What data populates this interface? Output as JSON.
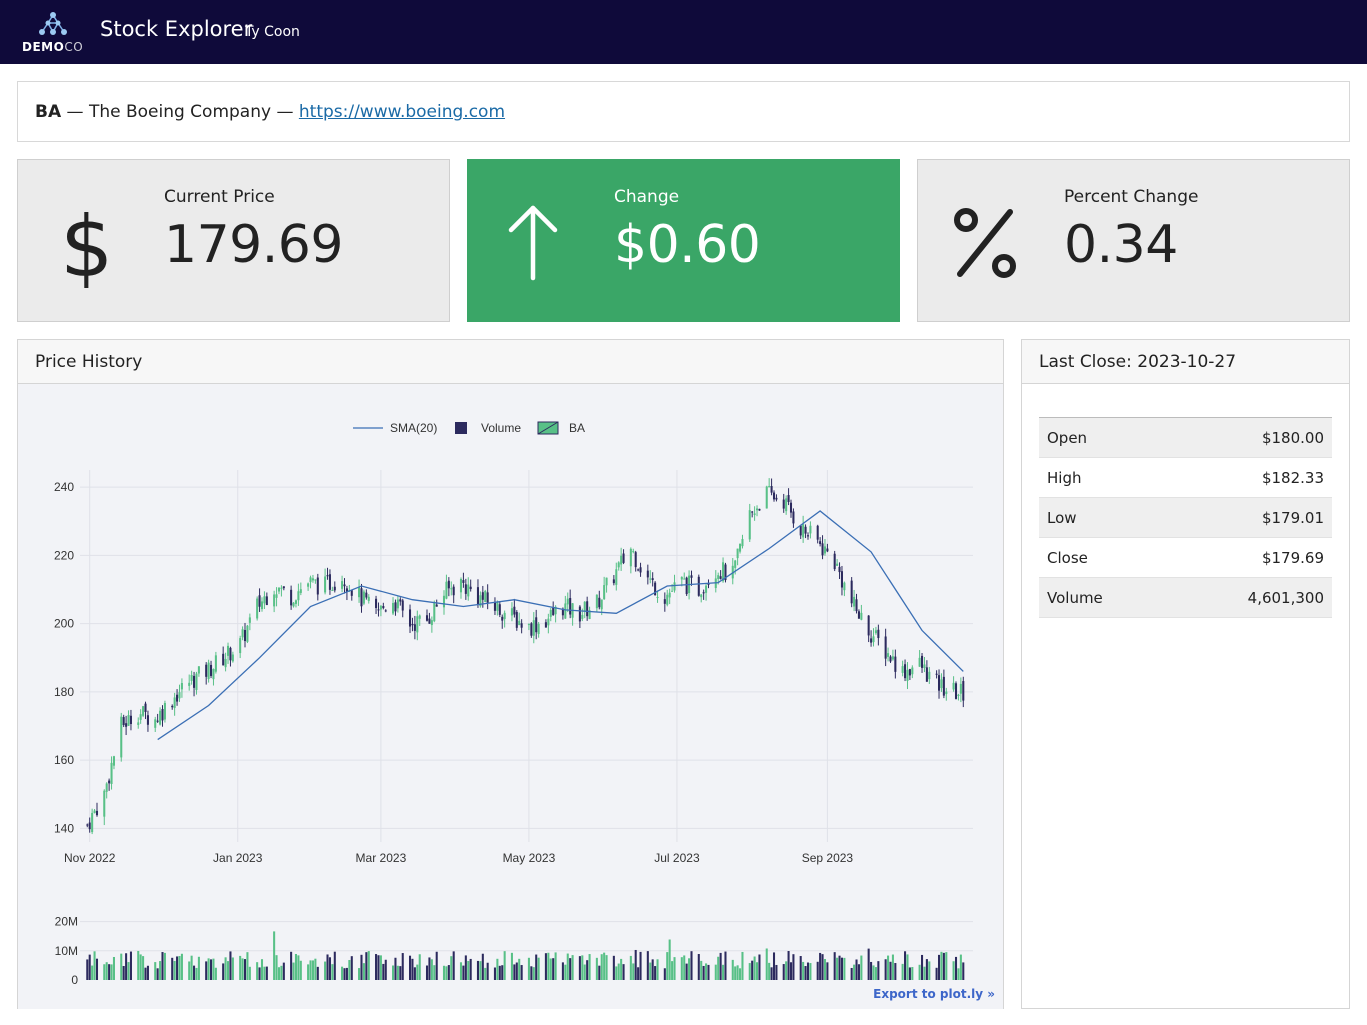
{
  "header": {
    "logo_text_bold": "DEMO",
    "logo_text_light": "CO",
    "title": "Stock Explorer",
    "user": "Ty Coon"
  },
  "company": {
    "ticker": "BA",
    "name": "The Boeing Company",
    "url": "https://www.boeing.com"
  },
  "kpis": {
    "price": {
      "label": "Current Price",
      "value": "179.69",
      "icon": "dollar-icon"
    },
    "change": {
      "label": "Change",
      "value": "$0.60",
      "icon": "arrow-up-icon",
      "color": "#3aa667"
    },
    "percent": {
      "label": "Percent Change",
      "value": "0.34",
      "icon": "percent-icon"
    }
  },
  "price_history": {
    "title": "Price History",
    "export_label": "Export to plot.ly »"
  },
  "last_close": {
    "title": "Last Close: 2023-10-27",
    "rows": [
      {
        "label": "Open",
        "value": "$180.00"
      },
      {
        "label": "High",
        "value": "$182.33"
      },
      {
        "label": "Low",
        "value": "$179.01"
      },
      {
        "label": "Close",
        "value": "$179.69"
      },
      {
        "label": "Volume",
        "value": "4,601,300"
      }
    ]
  },
  "colors": {
    "up": "#58c087",
    "down": "#2c2a5e",
    "sma": "#3b6fb5",
    "header_bg": "#0f0a3a"
  },
  "chart_data": {
    "type": "candlestick",
    "legend": [
      "SMA(20)",
      "Volume",
      "BA"
    ],
    "legend_placement": "top-center",
    "grid": true,
    "x_ticks": [
      "Nov 2022",
      "Jan 2023",
      "Mar 2023",
      "May 2023",
      "Jul 2023",
      "Sep 2023"
    ],
    "y_ticks": [
      140,
      160,
      180,
      200,
      220,
      240
    ],
    "ylim": [
      136,
      245
    ],
    "volume_ticks": [
      "0",
      "10M",
      "20M"
    ],
    "volume_ylim": [
      0,
      25000000
    ],
    "close_path": [
      [
        "2022-10-31",
        141
      ],
      [
        "2022-11-07",
        150
      ],
      [
        "2022-11-14",
        170
      ],
      [
        "2022-11-21",
        174
      ],
      [
        "2022-11-28",
        172
      ],
      [
        "2022-12-05",
        178
      ],
      [
        "2022-12-12",
        183
      ],
      [
        "2022-12-19",
        186
      ],
      [
        "2022-12-26",
        190
      ],
      [
        "2023-01-02",
        194
      ],
      [
        "2023-01-09",
        205
      ],
      [
        "2023-01-16",
        211
      ],
      [
        "2023-01-23",
        208
      ],
      [
        "2023-01-30",
        212
      ],
      [
        "2023-02-06",
        211
      ],
      [
        "2023-02-13",
        214
      ],
      [
        "2023-02-20",
        208
      ],
      [
        "2023-02-27",
        203
      ],
      [
        "2023-03-06",
        207
      ],
      [
        "2023-03-13",
        200
      ],
      [
        "2023-03-20",
        201
      ],
      [
        "2023-03-27",
        209
      ],
      [
        "2023-04-03",
        212
      ],
      [
        "2023-04-10",
        208
      ],
      [
        "2023-04-17",
        205
      ],
      [
        "2023-04-24",
        202
      ],
      [
        "2023-05-01",
        199
      ],
      [
        "2023-05-08",
        201
      ],
      [
        "2023-05-15",
        205
      ],
      [
        "2023-05-22",
        203
      ],
      [
        "2023-05-29",
        206
      ],
      [
        "2023-06-05",
        214
      ],
      [
        "2023-06-12",
        222
      ],
      [
        "2023-06-19",
        213
      ],
      [
        "2023-06-26",
        208
      ],
      [
        "2023-07-03",
        212
      ],
      [
        "2023-07-10",
        210
      ],
      [
        "2023-07-17",
        216
      ],
      [
        "2023-07-24",
        214
      ],
      [
        "2023-07-31",
        232
      ],
      [
        "2023-08-07",
        238
      ],
      [
        "2023-08-14",
        236
      ],
      [
        "2023-08-21",
        228
      ],
      [
        "2023-08-28",
        224
      ],
      [
        "2023-09-04",
        218
      ],
      [
        "2023-09-11",
        206
      ],
      [
        "2023-09-18",
        198
      ],
      [
        "2023-09-25",
        192
      ],
      [
        "2023-10-02",
        186
      ],
      [
        "2023-10-09",
        188
      ],
      [
        "2023-10-16",
        182
      ],
      [
        "2023-10-23",
        180
      ],
      [
        "2023-10-27",
        179.69
      ]
    ],
    "sma_path": [
      [
        "2022-11-29",
        166
      ],
      [
        "2022-12-20",
        176
      ],
      [
        "2023-01-10",
        190
      ],
      [
        "2023-01-31",
        205
      ],
      [
        "2023-02-21",
        211
      ],
      [
        "2023-03-14",
        207
      ],
      [
        "2023-04-04",
        205
      ],
      [
        "2023-04-25",
        207
      ],
      [
        "2023-05-16",
        204
      ],
      [
        "2023-06-06",
        203
      ],
      [
        "2023-06-27",
        211
      ],
      [
        "2023-07-18",
        212
      ],
      [
        "2023-08-08",
        222
      ],
      [
        "2023-08-29",
        233
      ],
      [
        "2023-09-19",
        221
      ],
      [
        "2023-10-10",
        198
      ],
      [
        "2023-10-27",
        186
      ]
    ]
  }
}
